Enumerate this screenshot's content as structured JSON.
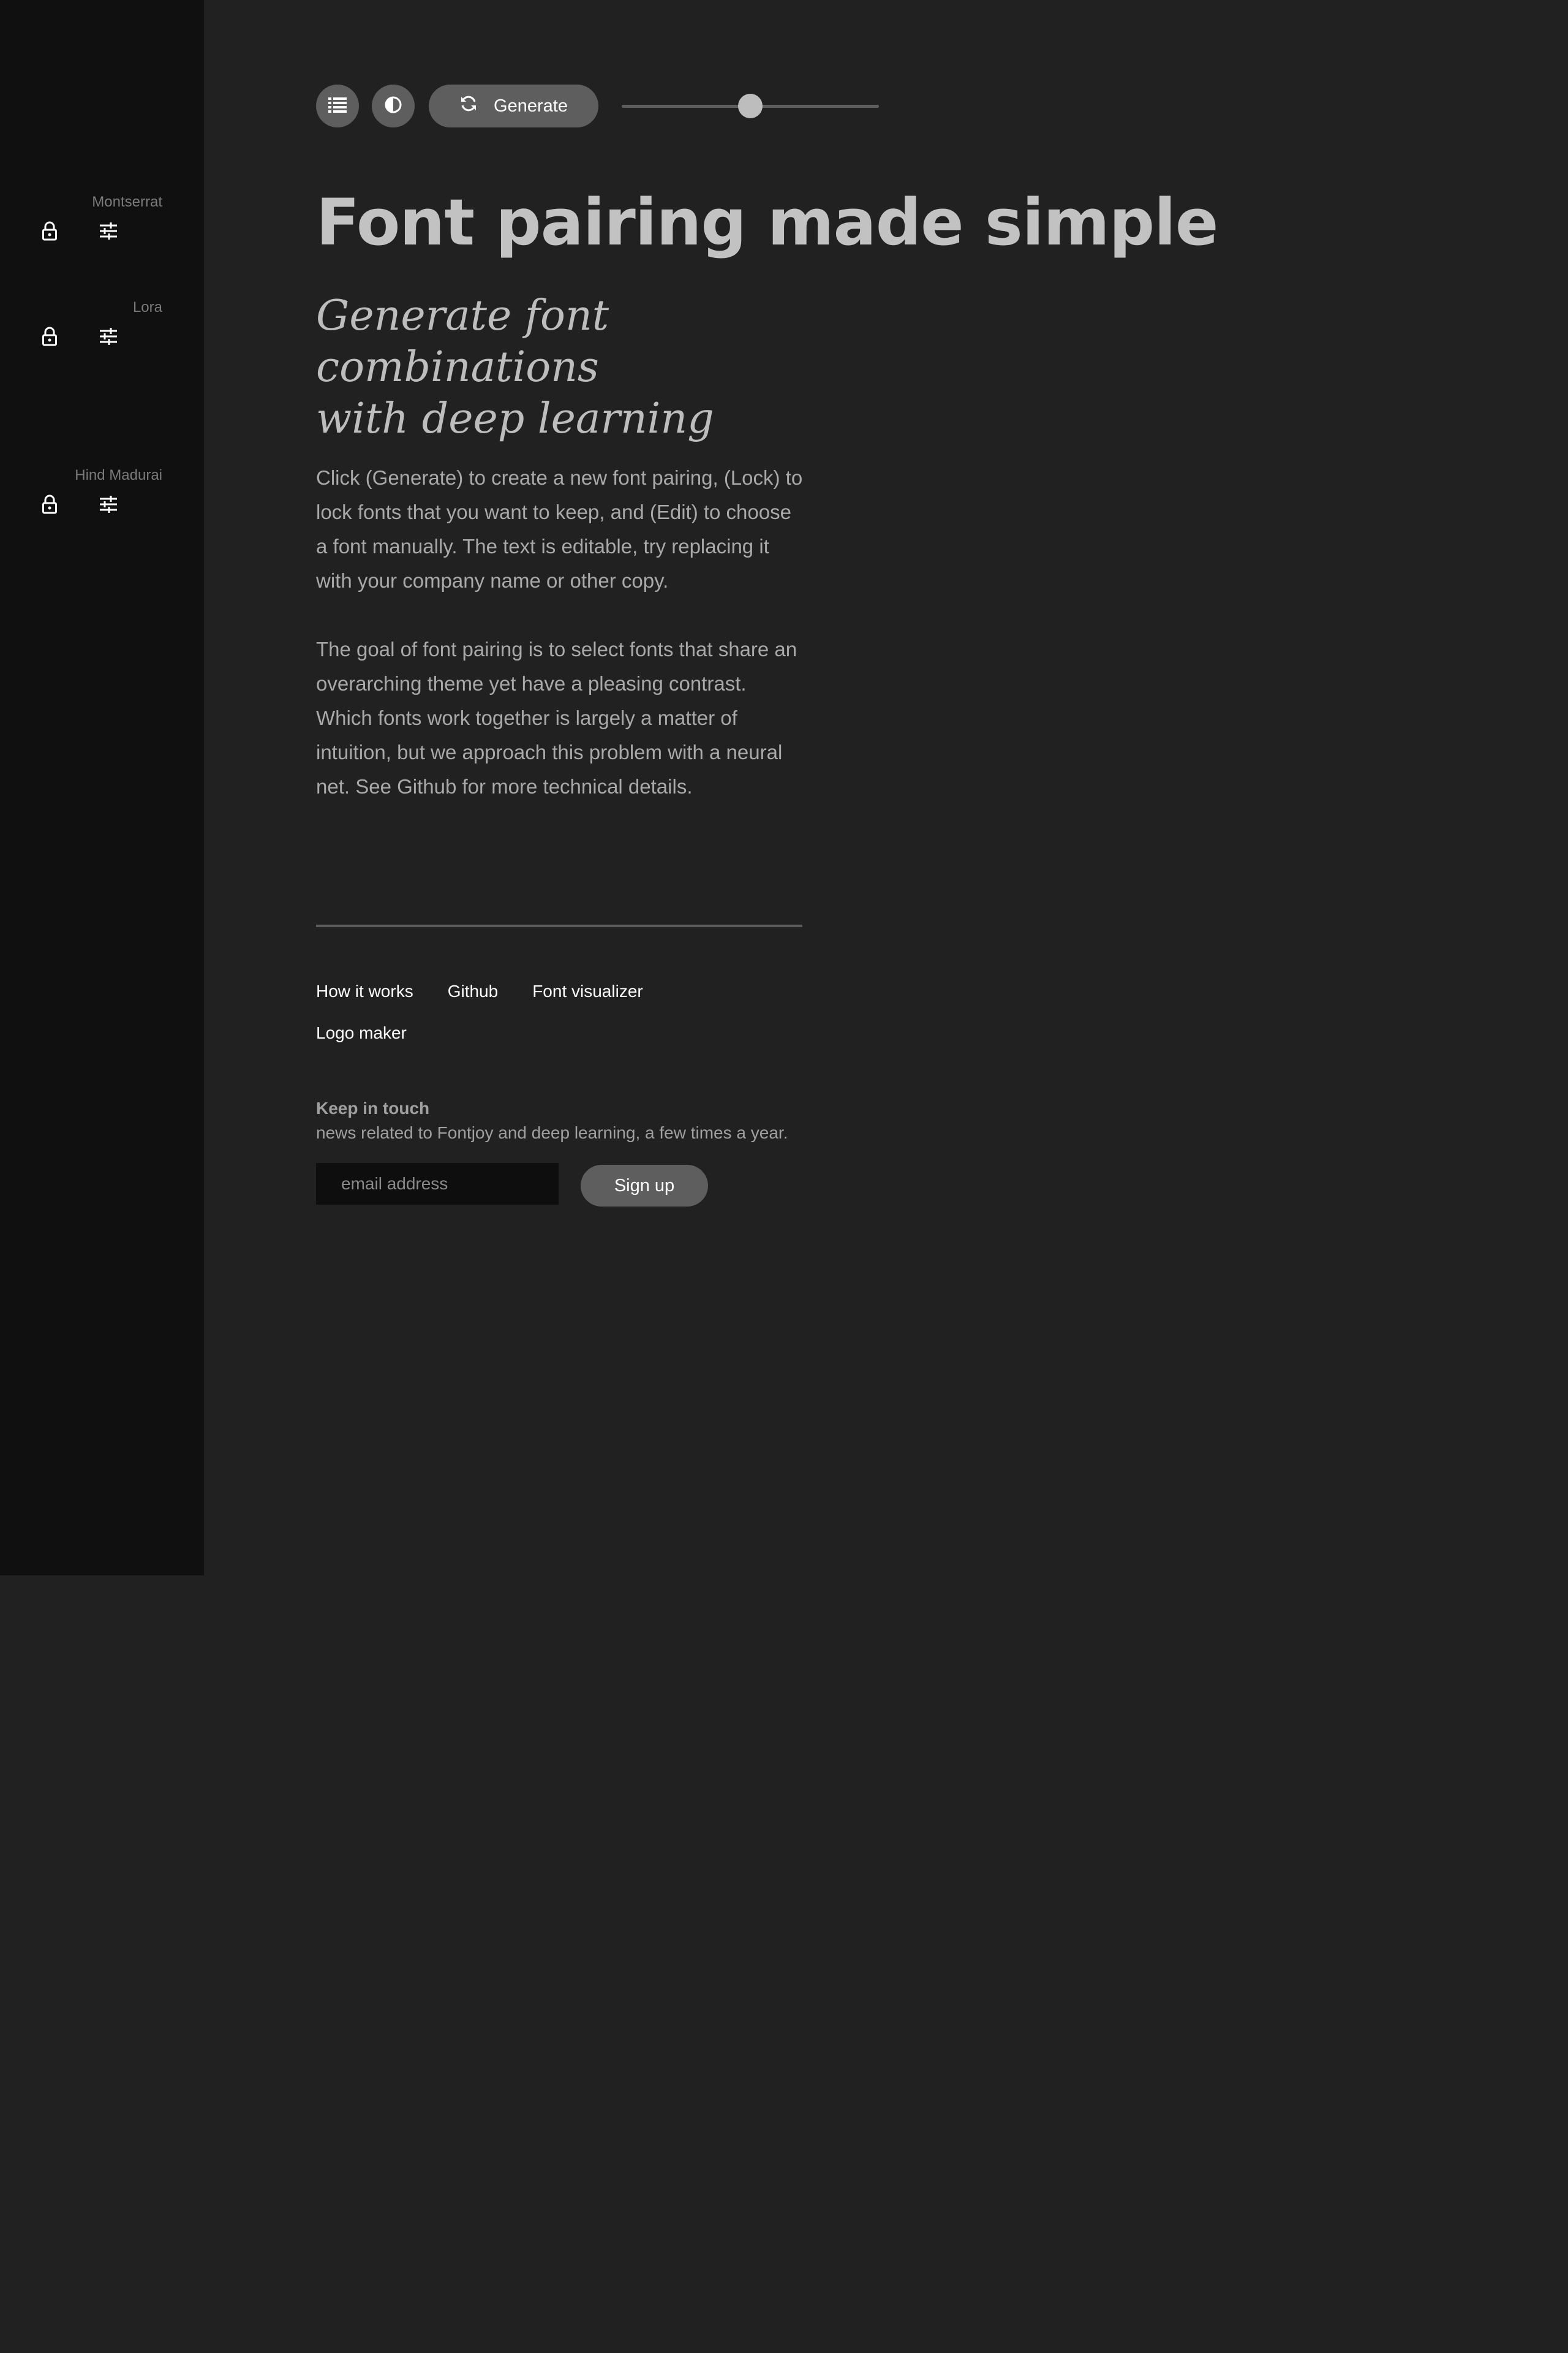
{
  "sidebar": {
    "fonts": [
      {
        "name": "Montserrat"
      },
      {
        "name": "Lora"
      },
      {
        "name": "Hind Madurai"
      }
    ]
  },
  "toolbar": {
    "list_icon": "list-icon",
    "contrast_icon": "contrast-icon",
    "generate_label": "Generate",
    "generate_icon": "refresh-icon",
    "slider_value": 0.5
  },
  "main": {
    "headline": "Font pairing made simple",
    "subhead_line1": "Generate font combinations",
    "subhead_line2": "with deep learning",
    "paragraph1": "Click (Generate) to create a new font pairing, (Lock) to lock fonts that you want to keep, and (Edit) to choose a font manually. The text is editable, try replacing it with your company name or other copy.",
    "paragraph2": "The goal of font pairing is to select fonts that share an overarching theme yet have a pleasing contrast. Which fonts work together is largely a matter of intuition, but we approach this problem with a neural net. See Github for more technical details."
  },
  "footer": {
    "links": [
      "How it works",
      "Github",
      "Font visualizer",
      "Logo maker"
    ],
    "keep_in_touch_title": "Keep in touch",
    "keep_in_touch_desc": "news related to Fontjoy and deep learning, a few times a year.",
    "email_placeholder": "email address",
    "signup_label": "Sign up"
  },
  "colors": {
    "background": "#212121",
    "sidebar": "#101010",
    "button": "#5e5e5e",
    "text_primary": "#c2c2c2",
    "text_body": "#a9a9a9"
  }
}
